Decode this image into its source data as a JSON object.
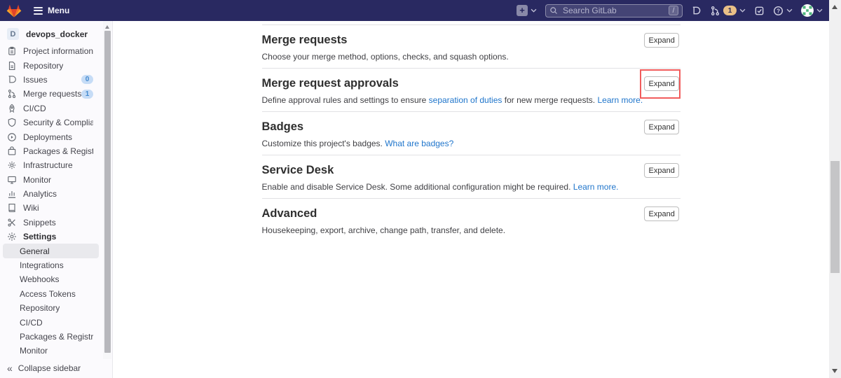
{
  "topbar": {
    "menu_label": "Menu",
    "new_button_plus": "+",
    "search_placeholder": "Search GitLab",
    "search_shortcut": "/",
    "mr_count": "1",
    "colors": {
      "navbar_bg": "#292961",
      "mr_badge_bg": "#e9bf87"
    }
  },
  "sidebar": {
    "project_initial": "D",
    "project_name": "devops_docker",
    "items": [
      {
        "label": "Project information",
        "icon": "project-information-icon"
      },
      {
        "label": "Repository",
        "icon": "repository-icon"
      },
      {
        "label": "Issues",
        "icon": "issues-icon",
        "badge": "0"
      },
      {
        "label": "Merge requests",
        "icon": "merge-requests-icon",
        "badge": "1"
      },
      {
        "label": "CI/CD",
        "icon": "ci-cd-icon"
      },
      {
        "label": "Security & Compliance",
        "icon": "security-icon"
      },
      {
        "label": "Deployments",
        "icon": "deployments-icon"
      },
      {
        "label": "Packages & Registries",
        "icon": "packages-icon"
      },
      {
        "label": "Infrastructure",
        "icon": "infrastructure-icon"
      },
      {
        "label": "Monitor",
        "icon": "monitor-icon"
      },
      {
        "label": "Analytics",
        "icon": "analytics-icon"
      },
      {
        "label": "Wiki",
        "icon": "wiki-icon"
      },
      {
        "label": "Snippets",
        "icon": "snippets-icon"
      },
      {
        "label": "Settings",
        "icon": "settings-icon",
        "bold": true
      },
      {
        "label": "General",
        "sub": true,
        "active": true
      },
      {
        "label": "Integrations",
        "sub": true
      },
      {
        "label": "Webhooks",
        "sub": true
      },
      {
        "label": "Access Tokens",
        "sub": true
      },
      {
        "label": "Repository",
        "sub": true
      },
      {
        "label": "CI/CD",
        "sub": true
      },
      {
        "label": "Packages & Registries",
        "sub": true
      },
      {
        "label": "Monitor",
        "sub": true
      }
    ],
    "badge_colors": {
      "bg": "#c6dcf6",
      "text": "#4389cf"
    },
    "collapse_label": "Collapse sidebar"
  },
  "main": {
    "sections": [
      {
        "title": "Merge requests",
        "desc": [
          {
            "t": "Choose your merge method, options, checks, and squash options."
          }
        ],
        "button": "Expand"
      },
      {
        "title": "Merge request approvals",
        "desc": [
          {
            "t": "Define approval rules and settings to ensure "
          },
          {
            "t": "separation of duties",
            "link": true
          },
          {
            "t": " for new merge requests. "
          },
          {
            "t": "Learn more.",
            "link": true
          }
        ],
        "button": "Expand",
        "highlight_button": true
      },
      {
        "title": "Badges",
        "desc": [
          {
            "t": "Customize this project's badges. "
          },
          {
            "t": "What are badges?",
            "link": true
          }
        ],
        "button": "Expand"
      },
      {
        "title": "Service Desk",
        "desc": [
          {
            "t": "Enable and disable Service Desk. Some additional configuration might be required. "
          },
          {
            "t": "Learn more.",
            "link": true
          }
        ],
        "button": "Expand"
      },
      {
        "title": "Advanced",
        "desc": [
          {
            "t": "Housekeeping, export, archive, change path, transfer, and delete."
          }
        ],
        "button": "Expand"
      }
    ],
    "colors": {
      "link": "#1f75cb",
      "highlight_box": "#f15c5c",
      "divider": "#e1e1e4"
    }
  }
}
